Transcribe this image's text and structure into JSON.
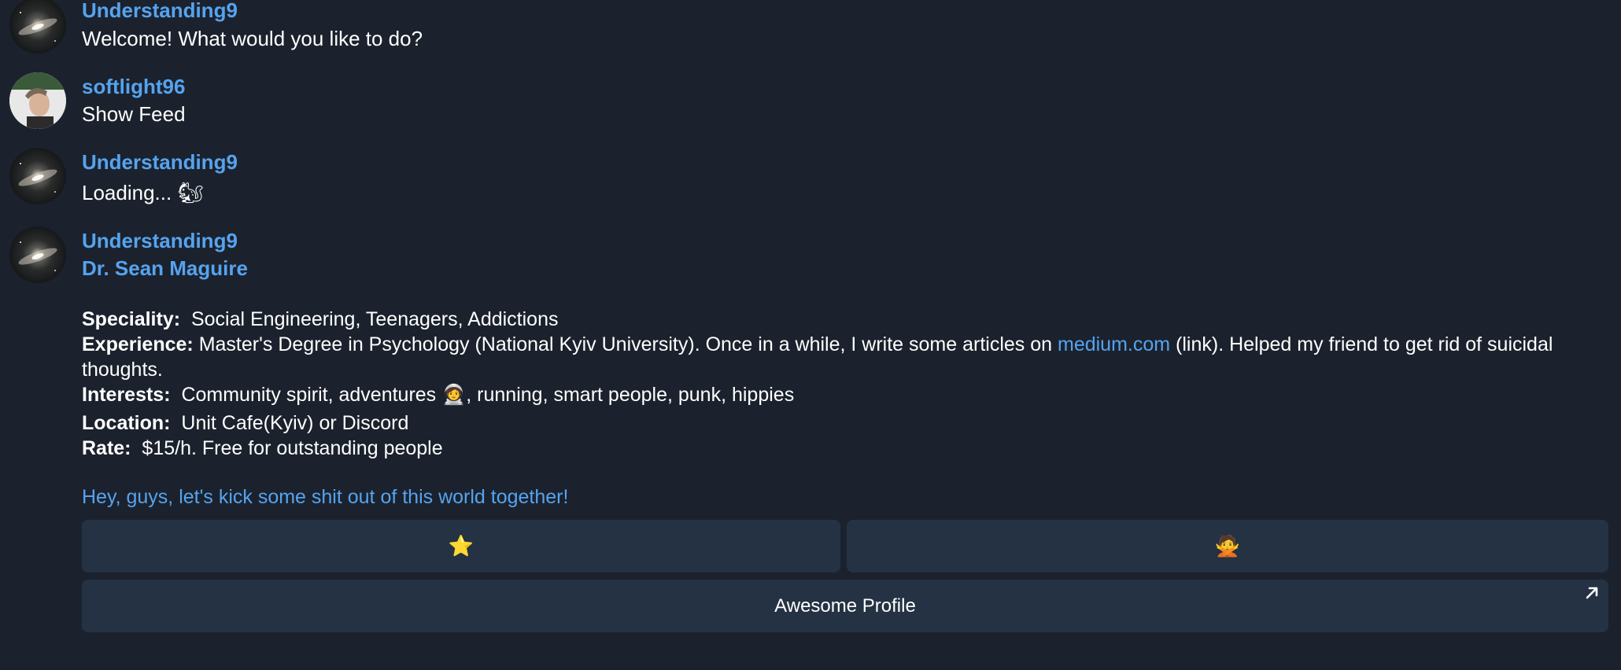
{
  "messages": [
    {
      "author": "Understanding9",
      "text": "Welcome! What would you like to do?"
    },
    {
      "author": "softlight96",
      "text": "Show Feed"
    },
    {
      "author": "Understanding9",
      "text": "Loading...",
      "emoji": "🐿"
    },
    {
      "author": "Understanding9",
      "profile": {
        "name": "Dr. Sean Maguire",
        "speciality_label": "Speciality:",
        "speciality": "Social Engineering, Teenagers, Addictions",
        "experience_label": "Experience:",
        "experience_before": "Master's Degree in Psychology (National Kyiv University). Once in a while, I write some articles on",
        "experience_link": "medium.com",
        "experience_after": "(link). Helped my friend to get rid of suicidal thoughts.",
        "interests_label": "Interests:",
        "interests_before": "Community spirit, adventures",
        "interests_emoji": "🧑‍🚀",
        "interests_after": ", running, smart people, punk, hippies",
        "location_label": "Location:",
        "location": "Unit Cafe(Kyiv) or Discord",
        "rate_label": "Rate:",
        "rate": "$15/h. Free for outstanding people",
        "cta": "Hey, guys, let's kick some shit out of this world together!"
      },
      "buttons": {
        "star_emoji": "⭐",
        "reject_emoji": "🙅",
        "profile_label": "Awesome Profile"
      }
    }
  ],
  "colors": {
    "background": "#1b222d",
    "accent": "#56a3ef",
    "button": "#243243"
  },
  "icons": {
    "external_link": "arrow-up-right-icon"
  }
}
